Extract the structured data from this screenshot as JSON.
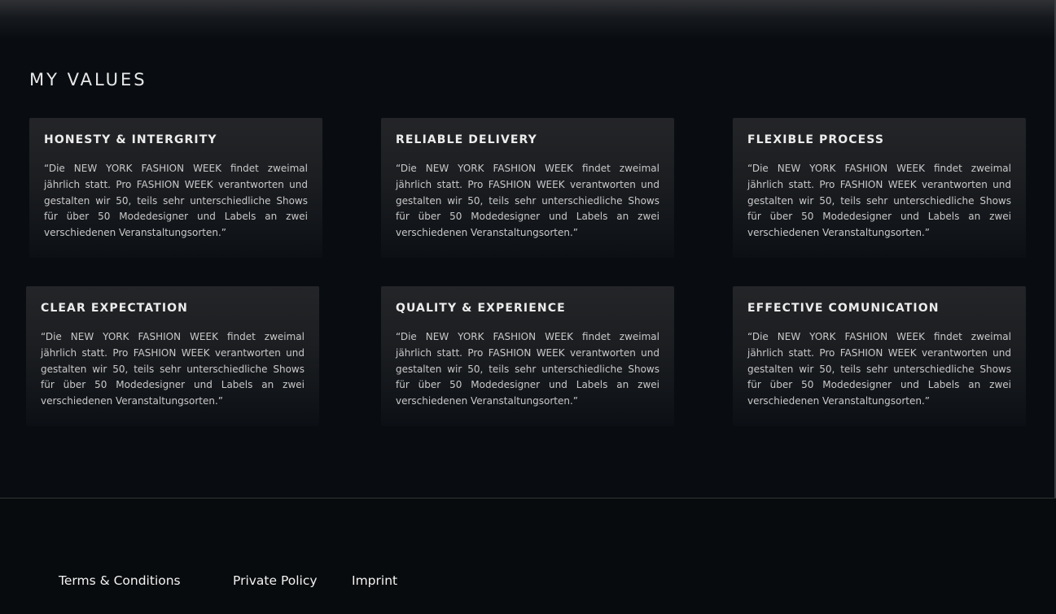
{
  "values": {
    "title": "MY VALUES",
    "cards": [
      {
        "title": "HONESTY & INTERGRITY",
        "text": "“Die NEW YORK FASHION WEEK findet zweimal jährlich statt. Pro FASHION WEEK verantworten und gestalten wir 50, teils sehr unterschiedliche Shows für über 50 Modedesigner und Labels an zwei verschiedenen Veranstaltungsorten.”"
      },
      {
        "title": "RELIABLE DELIVERY",
        "text": "“Die NEW YORK FASHION WEEK findet zweimal jährlich statt. Pro FASHION WEEK verantworten und gestalten wir 50, teils sehr unterschiedliche Shows für über 50 Modedesigner und Labels an zwei verschiedenen Veranstaltungsorten.”"
      },
      {
        "title": "FLEXIBLE PROCESS",
        "text": "“Die NEW YORK FASHION WEEK findet zweimal jährlich statt. Pro FASHION WEEK verantworten und gestalten wir 50, teils sehr unterschiedliche Shows für über 50 Modedesigner und Labels an zwei verschiedenen Veranstaltungsorten.”"
      },
      {
        "title": "CLEAR EXPECTATION",
        "text": "“Die NEW YORK FASHION WEEK findet zweimal jährlich statt. Pro FASHION WEEK verantworten und gestalten wir 50, teils sehr unterschiedliche Shows für über 50 Modedesigner und Labels an zwei verschiedenen Veranstaltungsorten.”"
      },
      {
        "title": "QUALITY & EXPERIENCE",
        "text": "“Die NEW YORK FASHION WEEK findet zweimal jährlich statt. Pro FASHION WEEK verantworten und gestalten wir 50, teils sehr unterschiedliche Shows für über 50 Modedesigner und Labels an zwei verschiedenen Veranstaltungsorten.”"
      },
      {
        "title": "EFFECTIVE COMUNICATION",
        "text": "“Die NEW YORK FASHION WEEK findet zweimal jährlich statt. Pro FASHION WEEK verantworten und gestalten wir 50, teils sehr unterschiedliche Shows für über 50 Modedesigner und Labels an zwei verschiedenen Veranstaltungsorten.”"
      }
    ]
  },
  "footer": {
    "links": [
      "Terms & Conditions",
      "Private Policy",
      "Imprint"
    ]
  },
  "colors": {
    "background": "#090d12",
    "card_top": "#242528",
    "footer_background": "#080b0d",
    "text": "#c9c9c9",
    "heading": "#ececec"
  }
}
